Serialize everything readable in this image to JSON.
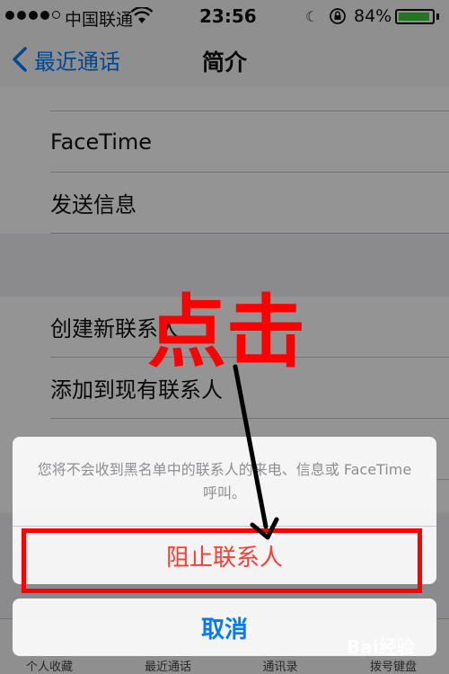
{
  "status_bar": {
    "carrier": "中国联通",
    "time": "23:56",
    "battery": "84%"
  },
  "nav": {
    "back_label": "最近通话",
    "title": "简介"
  },
  "list": {
    "row_facetime": "FaceTime",
    "row_send_message": "发送信息",
    "row_create_contact": "创建新联系人",
    "row_add_existing": "添加到现有联系人"
  },
  "tabs": {
    "favorites": "个人收藏",
    "recents": "最近通话",
    "contacts": "通讯录",
    "keypad": "拨号键盘"
  },
  "action_sheet": {
    "message": "您将不会收到黑名单中的联系人的来电、信息或 FaceTime 呼叫。",
    "block_button": "阻止联系人",
    "cancel_button": "取消"
  },
  "annotation": {
    "text": "点击"
  },
  "watermark": "Bai经验",
  "colors": {
    "ios_blue": "#007aff",
    "destructive_red": "#ff3b30",
    "annotation_red": "#ff0000",
    "battery_green": "#3ec83b"
  }
}
